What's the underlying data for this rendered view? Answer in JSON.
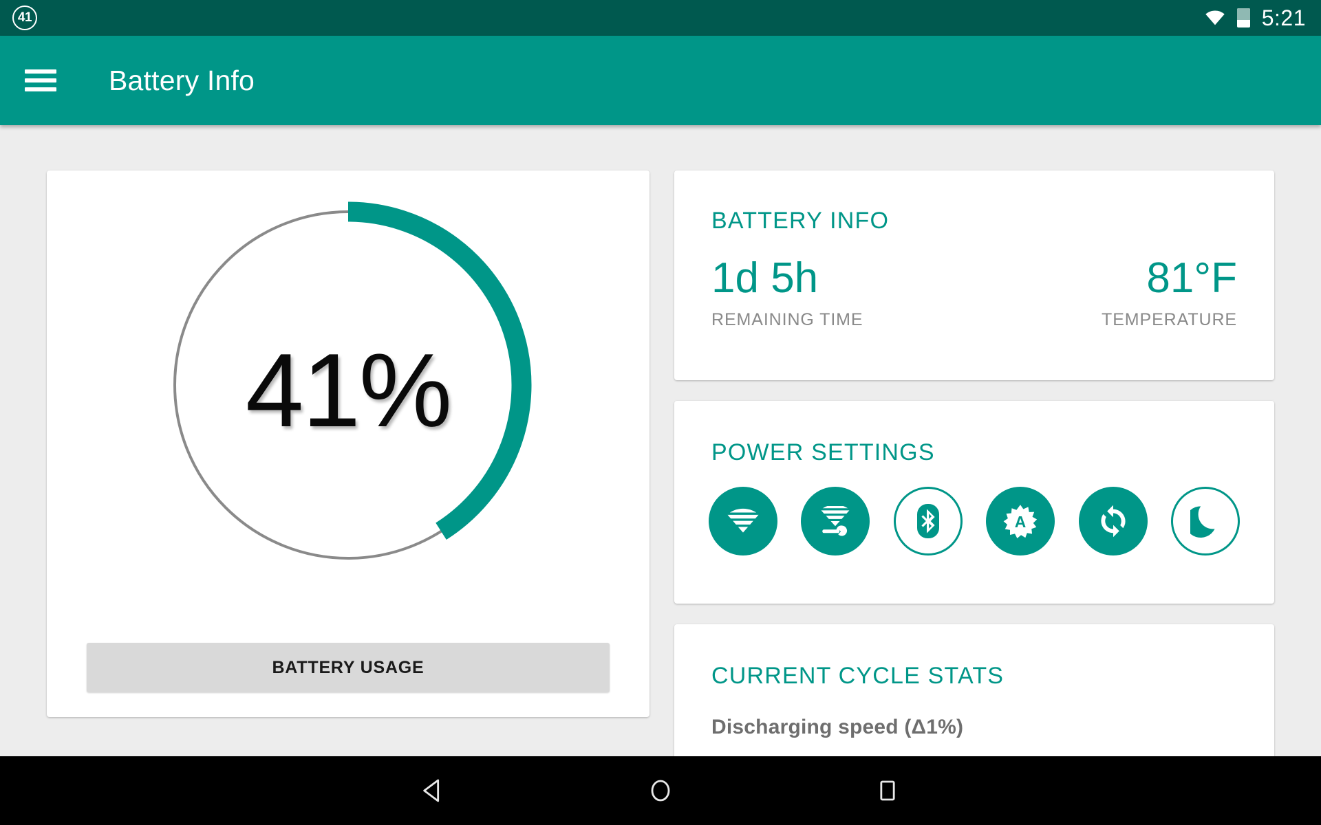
{
  "status_bar": {
    "notification_badge": "41",
    "wifi_icon": "wifi-icon",
    "battery_icon": "battery-icon",
    "time": "5:21",
    "background_color": "#00594f"
  },
  "app_bar": {
    "menu_icon": "hamburger-menu-icon",
    "title": "Battery Info",
    "background_color": "#009688"
  },
  "gauge": {
    "percent_label": "41%",
    "percent_value": 41,
    "arc_color": "#009688",
    "track_color": "#8a8a8a",
    "usage_button_label": "BATTERY USAGE"
  },
  "battery_info_card": {
    "title": "BATTERY INFO",
    "remaining_time_value": "1d 5h",
    "remaining_time_label": "REMAINING TIME",
    "temperature_value": "81°F",
    "temperature_label": "TEMPERATURE",
    "accent_color": "#009688"
  },
  "power_settings_card": {
    "title": "POWER SETTINGS",
    "toggles": [
      {
        "name": "wifi",
        "icon": "wifi-icon",
        "state": "on"
      },
      {
        "name": "wifi-settings",
        "icon": "wifi-wrench-icon",
        "state": "on"
      },
      {
        "name": "bluetooth",
        "icon": "bluetooth-icon",
        "state": "off"
      },
      {
        "name": "auto-brightness",
        "icon": "auto-brightness-icon",
        "state": "on"
      },
      {
        "name": "auto-sync",
        "icon": "sync-icon",
        "state": "on"
      },
      {
        "name": "night-mode",
        "icon": "moon-icon",
        "state": "off"
      }
    ]
  },
  "cycle_stats_card": {
    "title": "CURRENT CYCLE STATS",
    "first_row_label": "Discharging speed (Δ1%)"
  },
  "nav_bar": {
    "back_icon": "back-triangle-icon",
    "home_icon": "home-circle-icon",
    "recents_icon": "recents-square-icon"
  }
}
